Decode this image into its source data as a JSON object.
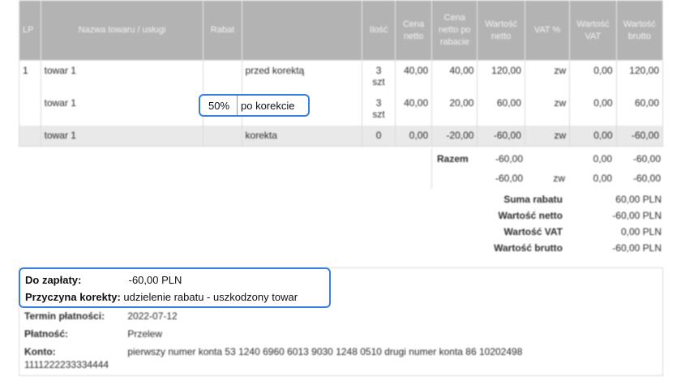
{
  "table": {
    "headers": [
      "LP",
      "Nazwa towaru / usługi",
      "Rabat",
      "",
      "Ilość",
      "Cena netto",
      "Cena netto po rabacie",
      "Wartość netto",
      "VAT %",
      "Wartość VAT",
      "Wartość brutto"
    ],
    "rows": [
      {
        "lp": "1",
        "name": "towar 1",
        "rabat": "",
        "kind": "przed korektą",
        "qty": "3",
        "unit": "szt",
        "price": "40,00",
        "price_after": "40,00",
        "net": "120,00",
        "vat_rate": "zw",
        "vat": "0,00",
        "gross": "120,00"
      },
      {
        "lp": "",
        "name": "towar 1",
        "rabat": "50%",
        "kind": "po korekcie",
        "qty": "3",
        "unit": "szt",
        "price": "40,00",
        "price_after": "20,00",
        "net": "60,00",
        "vat_rate": "zw",
        "vat": "0,00",
        "gross": "60,00"
      },
      {
        "lp": "",
        "name": "towar 1",
        "rabat": "",
        "kind": "korekta",
        "qty": "0",
        "unit": "",
        "price": "0,00",
        "price_after": "-20,00",
        "net": "-60,00",
        "vat_rate": "zw",
        "vat": "0,00",
        "gross": "-60,00"
      }
    ]
  },
  "razem": {
    "label": "Razem",
    "row1": {
      "net": "-60,00",
      "vat_rate": "",
      "vat": "0,00",
      "gross": "-60,00"
    },
    "row2": {
      "net": "-60,00",
      "vat_rate": "zw",
      "vat": "0,00",
      "gross": "-60,00"
    }
  },
  "summary": [
    {
      "label": "Suma rabatu",
      "value": "60,00 PLN"
    },
    {
      "label": "Wartość netto",
      "value": "-60,00 PLN"
    },
    {
      "label": "Wartość VAT",
      "value": "0,00 PLN"
    },
    {
      "label": "Wartość brutto",
      "value": "-60,00 PLN"
    }
  ],
  "payment": {
    "to_pay_label": "Do zapłaty:",
    "to_pay_value": "-60,00 PLN",
    "reason_label": "Przyczyna korekty:",
    "reason_value": "udzielenie rabatu - uszkodzony towar",
    "term_label": "Termin płatności:",
    "term_value": "2022-07-12",
    "method_label": "Płatność:",
    "method_value": "Przelew",
    "account_label": "Konto:",
    "account_value_line1": "pierwszy numer konta 53 1240 6960 6013 9030 1248 0510 drugi numer konta 86 10202498",
    "account_value_line2": "1111222233334444"
  },
  "colors": {
    "highlight": "#3a7fe0",
    "header_bg": "#b3b3b3",
    "stripe": "#e9e9e9"
  }
}
